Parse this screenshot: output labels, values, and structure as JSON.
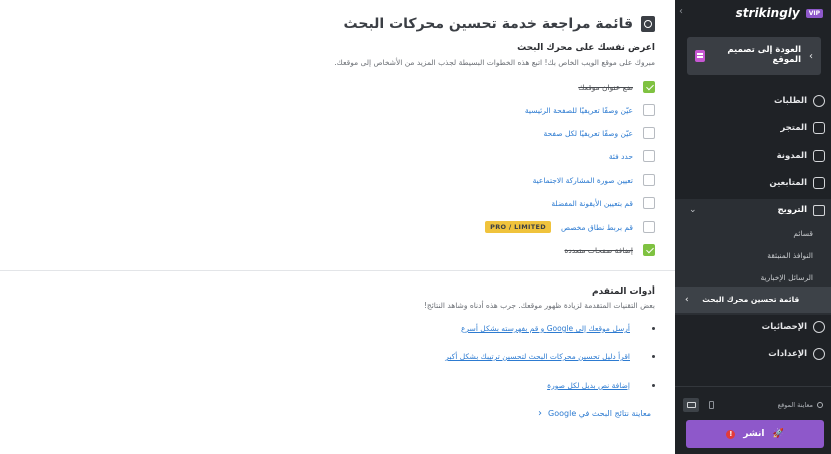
{
  "colors": {
    "accent": "#8e58ca",
    "link": "#2d7bd1",
    "done": "#7fc241",
    "sidebar_bg": "#1f2226",
    "badge": "#f0c33c",
    "alert": "#e23b3b"
  },
  "main": {
    "title": "قائمة مراجعة خدمة تحسين محركات البحث",
    "title_icon": "seo-search-icon",
    "intro": {
      "heading": "اعرض نفسك على محرك البحث",
      "desc": "مبروك على موقع الويب الخاص بك! اتبع هذه الخطوات البسيطة لجذب المزيد من الأشخاص إلى موقعك."
    },
    "checklist": [
      {
        "label": "ضع عنوان موقعك",
        "done": true
      },
      {
        "label": "عيّن وصفًا تعريفيًا للصفحة الرئيسية",
        "done": false
      },
      {
        "label": "عيّن وصفًا تعريفيًا لكل صفحة",
        "done": false
      },
      {
        "label": "حدد فئة",
        "done": false
      },
      {
        "label": "تعيين صورة المشاركة الاجتماعية",
        "done": false
      },
      {
        "label": "قم بتعيين الأيقونة المفضلة",
        "done": false
      },
      {
        "label": "قم بربط نطاق مخصص",
        "done": false,
        "badge": "PRO / LIMITED"
      },
      {
        "label": "إضافة صفحات متعددة",
        "done": true
      }
    ],
    "advanced": {
      "heading": "أدوات المتقدم",
      "desc": "بعض التقنيات المتقدمة لزيادة ظهور موقعك. جرب هذه أدناه وشاهد النتائج!",
      "links": [
        "أرسل موقعك إلى Google و قم بفهرسته بشكل أسرع",
        "اقرأ دليل تحسين محركات البحث لتحسين ترتيبك بشكل أكبر",
        "إضافة نص بديل لكل صورة"
      ],
      "google_preview": "معاينة نتائج البحث في Google"
    }
  },
  "sidebar": {
    "brand": "strikingly",
    "vip": "VIP",
    "back_label": "العودة إلى تصميم الموقع",
    "nav": [
      {
        "label": "الطلبات",
        "icon": "dollar-icon"
      },
      {
        "label": "المتجر",
        "icon": "store-icon"
      },
      {
        "label": "المدونة",
        "icon": "pen-icon"
      },
      {
        "label": "المتابعين",
        "icon": "followers-icon"
      }
    ],
    "promotion": {
      "label": "الترويج",
      "icon": "megaphone-icon",
      "sub_items": [
        "قسائم",
        "النوافذ المنبثقة",
        "الرسائل الإخبارية"
      ],
      "active_item": "قائمة تحسين محرك البحث"
    },
    "nav_bottom": [
      {
        "label": "الإحصائيات",
        "icon": "pie-chart-icon"
      },
      {
        "label": "الإعدادات",
        "icon": "gear-icon"
      }
    ],
    "preview_label": "معاينة الموقع",
    "publish_label": "انشر",
    "publish_alert": "!"
  }
}
